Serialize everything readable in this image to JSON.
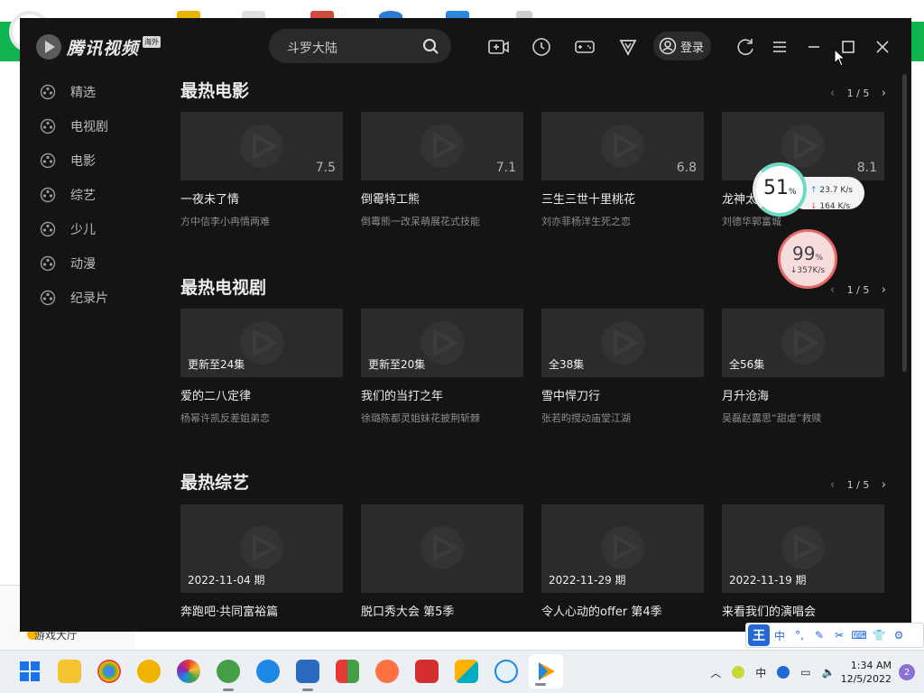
{
  "app": {
    "logo_text": "腾讯视频",
    "logo_badge": "海外",
    "search_placeholder": "斗罗大陆",
    "login_label": "登录"
  },
  "titlebar_icons": [
    "record-icon",
    "history-icon",
    "game-icon",
    "vip-icon",
    "refresh-icon",
    "menu-icon",
    "minimize-icon",
    "maximize-icon",
    "close-icon"
  ],
  "sidebar": {
    "items": [
      {
        "label": "精选",
        "icon": "featured-icon"
      },
      {
        "label": "电视剧",
        "icon": "tv-series-icon"
      },
      {
        "label": "电影",
        "icon": "movie-icon"
      },
      {
        "label": "综艺",
        "icon": "variety-icon"
      },
      {
        "label": "少儿",
        "icon": "kids-icon"
      },
      {
        "label": "动漫",
        "icon": "anime-icon"
      },
      {
        "label": "纪录片",
        "icon": "documentary-icon"
      }
    ]
  },
  "sections": [
    {
      "title": "最热电影",
      "pager": "1 / 5",
      "cards": [
        {
          "title": "一夜未了情",
          "subtitle": "方中信李小冉情两难",
          "tag": "7.5",
          "tag_type": "rating"
        },
        {
          "title": "倒霉特工熊",
          "subtitle": "倒霉熊一改呆萌展花式技能",
          "tag": "7.1",
          "tag_type": "rating"
        },
        {
          "title": "三生三世十里桃花",
          "subtitle": "刘亦菲杨洋生死之恋",
          "tag": "6.8",
          "tag_type": "rating"
        },
        {
          "title": "龙神太子",
          "subtitle": "刘德华郭富城",
          "tag": "8.1",
          "tag_type": "rating"
        }
      ]
    },
    {
      "title": "最热电视剧",
      "pager": "1 / 5",
      "cards": [
        {
          "title": "爱的二八定律",
          "subtitle": "杨幂许凯反差姐弟恋",
          "tag": "更新至24集",
          "tag_type": "episode"
        },
        {
          "title": "我们的当打之年",
          "subtitle": "徐璐陈都灵姐妹花披荆斩棘",
          "tag": "更新至20集",
          "tag_type": "episode"
        },
        {
          "title": "雪中悍刀行",
          "subtitle": "张若昀搅动庙堂江湖",
          "tag": "全38集",
          "tag_type": "episode"
        },
        {
          "title": "月升沧海",
          "subtitle": "吴磊赵露思“甜虐”救赎",
          "tag": "全56集",
          "tag_type": "episode"
        }
      ]
    },
    {
      "title": "最热综艺",
      "pager": "1 / 5",
      "cards": [
        {
          "title": "奔跑吧·共同富裕篇",
          "subtitle": "",
          "tag": "2022-11-04 期",
          "tag_type": "episode"
        },
        {
          "title": "脱口秀大会 第5季",
          "subtitle": "",
          "tag": "",
          "tag_type": "episode"
        },
        {
          "title": "令人心动的offer 第4季",
          "subtitle": "",
          "tag": "2022-11-29 期",
          "tag_type": "episode"
        },
        {
          "title": "来看我们的演唱会",
          "subtitle": "",
          "tag": "2022-11-19 期",
          "tag_type": "episode"
        }
      ]
    }
  ],
  "net_widget": {
    "percent": "51",
    "percent_unit": "%",
    "upload": "23.7 K/s",
    "download": "164 K/s"
  },
  "mem_widget": {
    "percent": "99",
    "percent_unit": "%",
    "speed": "357K/s"
  },
  "ime_bar": {
    "logo": "王",
    "items": [
      "中",
      "°,",
      "✎",
      "✂",
      "⌨",
      "👕",
      "⚙"
    ]
  },
  "taskbar": {
    "apps": [
      "start-icon",
      "file-explorer-icon",
      "chrome-icon",
      "browser-icon",
      "color-app-icon",
      "green-browser-icon",
      "ie-icon",
      "monitor-app-icon",
      "tiles-app-icon",
      "firefox-icon",
      "red-app-icon",
      "puzzle-app-icon",
      "cloud-app-icon",
      "tencent-video-icon"
    ],
    "tray_lang": "中",
    "time": "1:34 AM",
    "date": "12/5/2022",
    "notifications": "2"
  },
  "background": {
    "left_panel_label": "游戏大厅"
  },
  "colors": {
    "app_bg": "#141414",
    "thumb_bg": "#2b2b2b",
    "accent_green": "#0fb451",
    "net_ring": "#6fd9c3",
    "mem_ring": "#e66a6a"
  }
}
